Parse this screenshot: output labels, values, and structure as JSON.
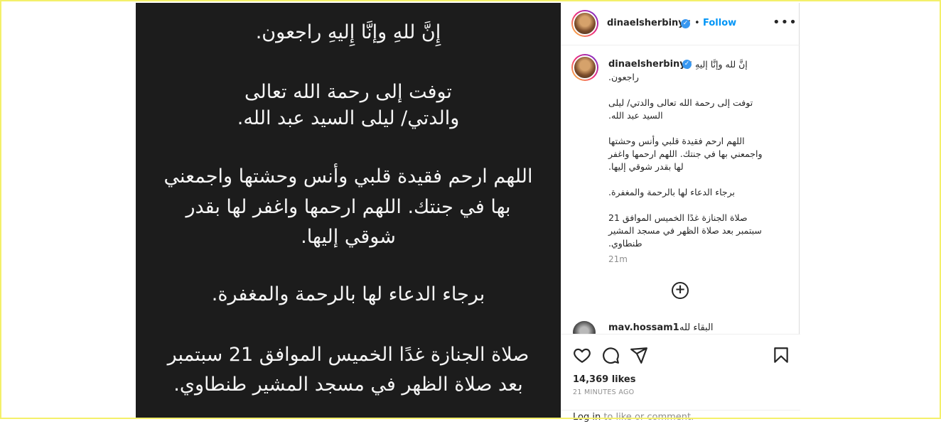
{
  "post": {
    "image_lines": [
      "إِنَّ للهِ وإنَّا إِليهِ راجعون.",
      "توفت إلى رحمة الله تعالى",
      "والدتي/ ليلى السيد عبد الله.",
      "اللهم ارحم فقيدة قلبي وأنس وحشتها واجمعني",
      "بها في جنتك. اللهم ارحمها واغفر لها بقدر",
      "شوقي إليها.",
      "برجاء الدعاء لها بالرحمة والمغفرة.",
      "صلاة الجنازة غدًا الخميس الموافق 21 سبتمبر",
      "بعد صلاة الظهر في مسجد المشير طنطاوي."
    ]
  },
  "header": {
    "username": "dinaelsherbinyy",
    "dot": "•",
    "follow_label": "Follow",
    "more_label": "•••"
  },
  "caption": {
    "username": "dinaelsherbinyy",
    "first_line": "إنَّ لله وإنَّا إليهِ",
    "lines": [
      "راجعون.",
      "",
      "توفت إلى رحمة الله تعالى والدتي/ ليلى",
      "السيد عبد الله.",
      "",
      "اللهم ارحم فقيدة قلبي وأنس وحشتها",
      "واجمعني بها في جنتك. اللهم ارحمها واغفر",
      "لها بقدر شوقي إليها.",
      "",
      "برجاء الدعاء لها بالرحمة والمغفرة.",
      "",
      "صلاة الجنازة غدًا الخميس الموافق 21",
      "سبتمبر بعد صلاة الظهر في مسجد المشير",
      "طنطاوي."
    ],
    "time": "21m"
  },
  "load_more_label": "+",
  "comment": {
    "username": "mav.hossam1",
    "text": "البقاء لله"
  },
  "actions": {
    "likes": "14,369 likes",
    "time_ago": "21 MINUTES AGO",
    "login_link": "Log in",
    "login_rest": " to like or comment."
  },
  "icons": [
    "heart-icon",
    "comment-icon",
    "share-icon",
    "bookmark-icon",
    "plus-circle-icon",
    "verified-icon",
    "more-icon"
  ],
  "colors": {
    "accent": "#0095f6",
    "verified": "#3897f0",
    "media_bg": "#1c1c1c"
  }
}
